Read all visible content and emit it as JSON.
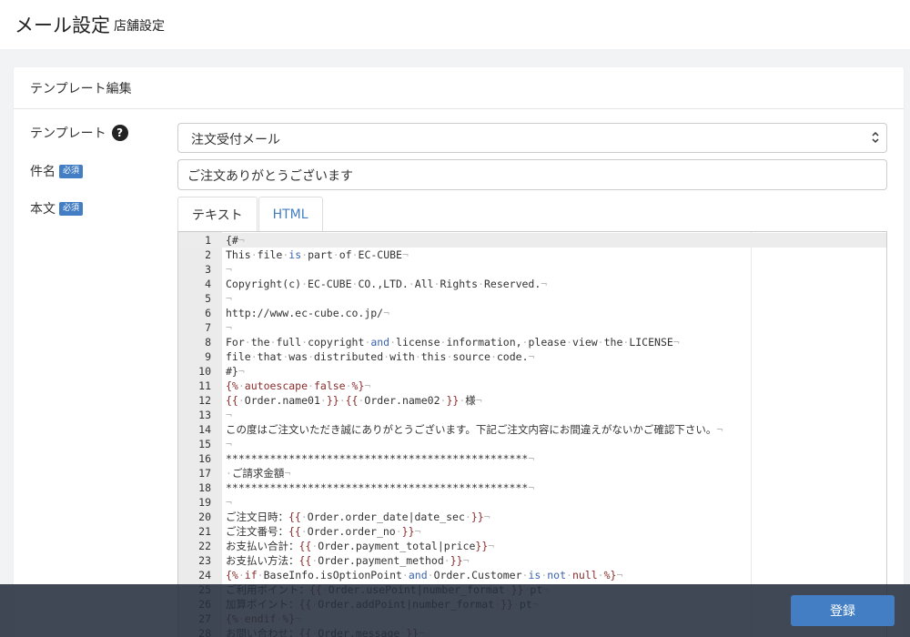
{
  "header": {
    "title": "メール設定",
    "subtitle": "店舗設定"
  },
  "card": {
    "title": "テンプレート編集"
  },
  "form": {
    "template_label": "テンプレート",
    "template_value": "注文受付メール",
    "subject_label": "件名",
    "body_label": "本文",
    "required_badge": "必須",
    "subject_value": "ご注文ありがとうございます"
  },
  "tabs": [
    "テキスト",
    "HTML"
  ],
  "editor": {
    "lines": [
      "{#¬",
      "This·file·is·part·of·EC-CUBE¬",
      "¬",
      "Copyright(c)·EC-CUBE·CO.,LTD.·All·Rights·Reserved.¬",
      "¬",
      "http://www.ec-cube.co.jp/¬",
      "¬",
      "For·the·full·copyright·and·license·information,·please·view·the·LICENSE¬",
      "file·that·was·distributed·with·this·source·code.¬",
      "#}¬",
      "{%·autoescape·false·%}¬",
      "{{·Order.name01·}}·{{·Order.name02·}}·様¬",
      "¬",
      "この度はご注文いただき誠にありがとうございます。下記ご注文内容にお間違えがないかご確認下さい。¬",
      "¬",
      "************************************************¬",
      "·ご請求金額¬",
      "************************************************¬",
      "¬",
      "ご注文日時：{{·Order.order_date|date_sec·}}¬",
      "ご注文番号：{{·Order.order_no·}}¬",
      "お支払い合計：{{·Order.payment_total|price}}¬",
      "お支払い方法：{{·Order.payment_method·}}¬",
      "{%·if·BaseInfo.isOptionPoint·and·Order.Customer·is·not·null·%}¬",
      "ご利用ポイント：{{·Order.usePoint|number_format·}}·pt¬",
      "加算ポイント：{{·Order.addPoint|number_format·}}·pt¬",
      "{%·endif·%}¬",
      "お問い合わせ：{{·Order.message·}}¬"
    ]
  },
  "footer": {
    "submit_label": "登録"
  }
}
